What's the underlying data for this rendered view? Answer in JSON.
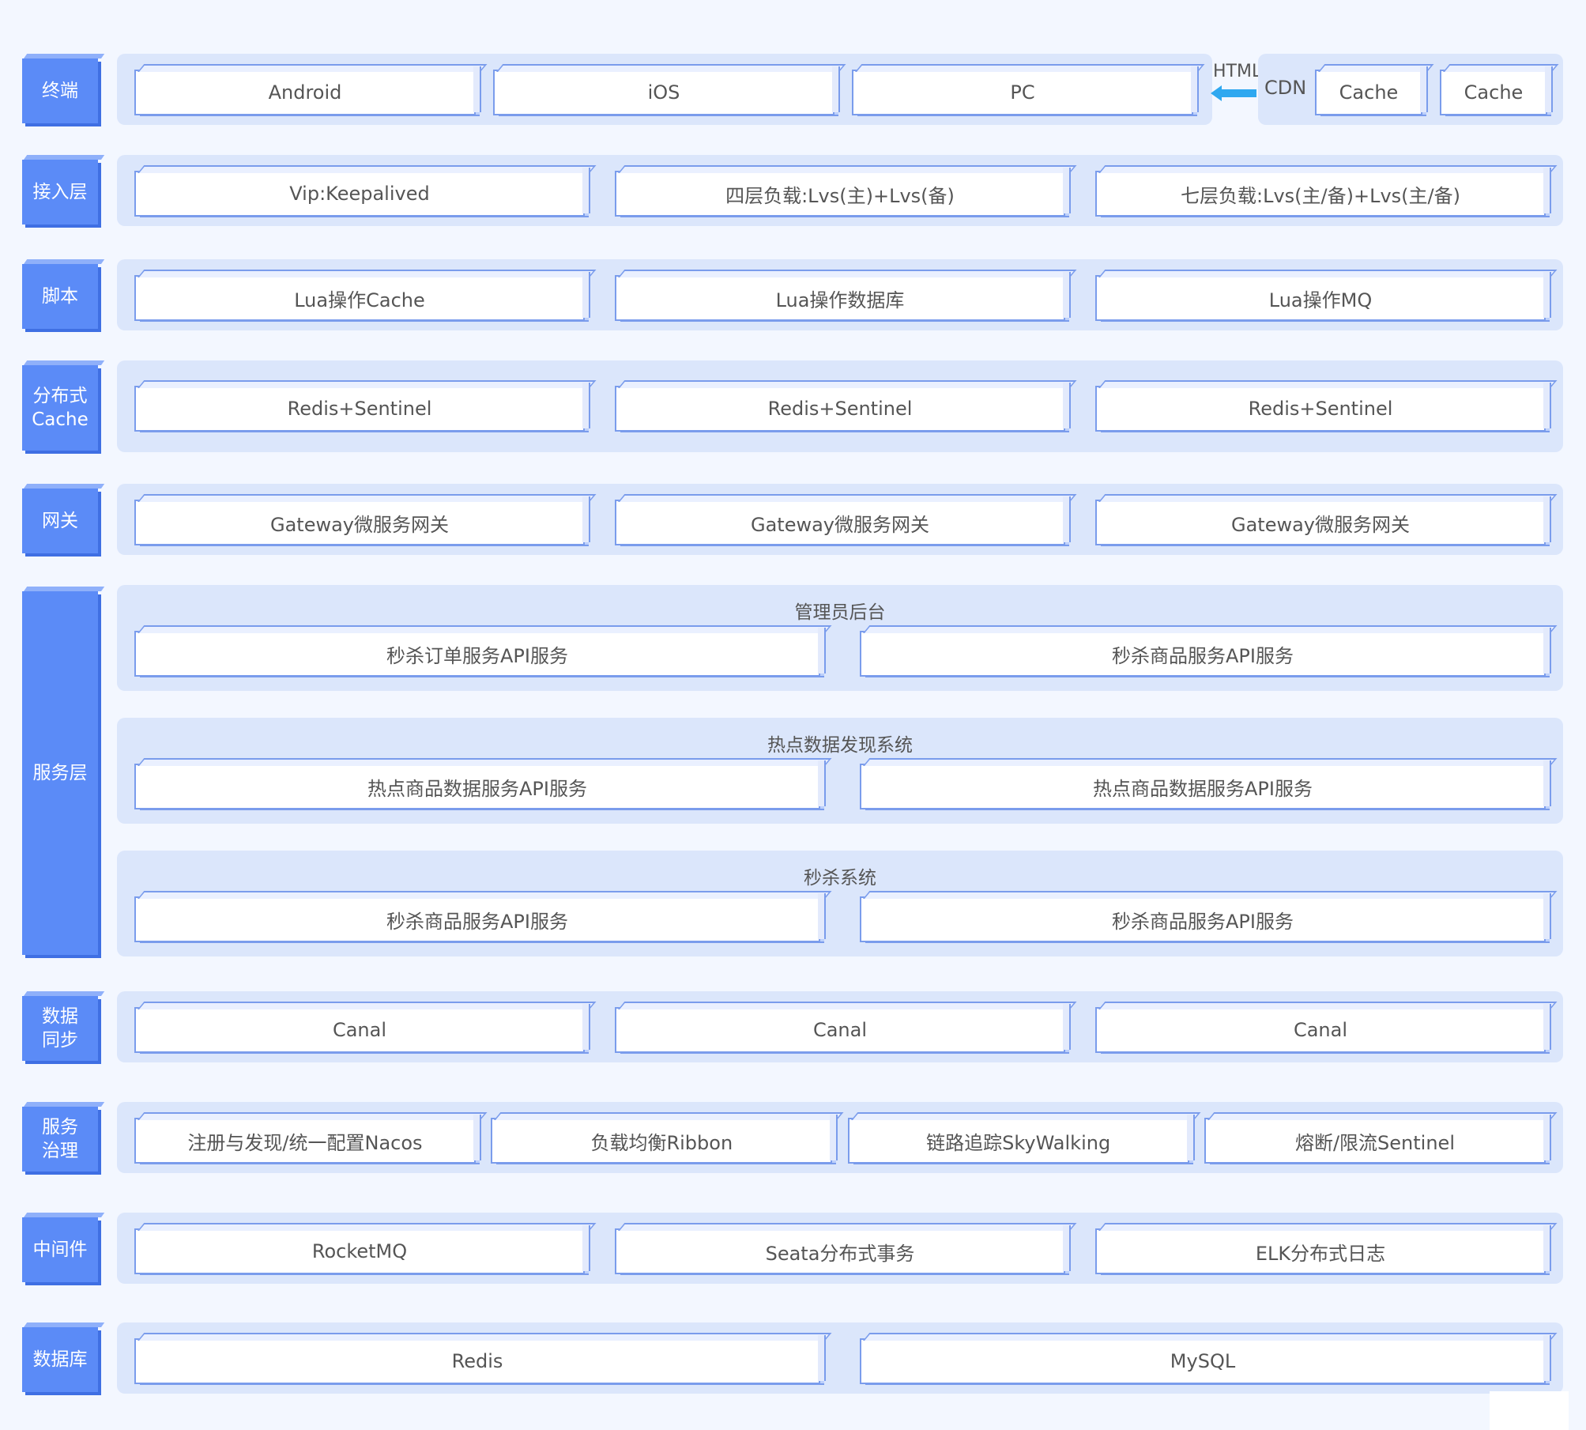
{
  "layers": {
    "terminal": {
      "label": "终端",
      "boxes": [
        "Android",
        "iOS",
        "PC"
      ],
      "html": "HTML",
      "cdn": "CDN",
      "cache": [
        "Cache",
        "Cache"
      ]
    },
    "access": {
      "label": "接入层",
      "boxes": [
        "Vip:Keepalived",
        "四层负载:Lvs(主)+Lvs(备)",
        "七层负载:Lvs(主/备)+Lvs(主/备)"
      ]
    },
    "script": {
      "label": "脚本",
      "boxes": [
        "Lua操作Cache",
        "Lua操作数据库",
        "Lua操作MQ"
      ]
    },
    "cache": {
      "label": "分布式Cache",
      "boxes": [
        "Redis+Sentinel",
        "Redis+Sentinel",
        "Redis+Sentinel"
      ]
    },
    "gateway": {
      "label": "网关",
      "boxes": [
        "Gateway微服务网关",
        "Gateway微服务网关",
        "Gateway微服务网关"
      ]
    },
    "service": {
      "label": "服务层",
      "groups": [
        {
          "title": "管理员后台",
          "boxes": [
            "秒杀订单服务API服务",
            "秒杀商品服务API服务"
          ]
        },
        {
          "title": "热点数据发现系统",
          "boxes": [
            "热点商品数据服务API服务",
            "热点商品数据服务API服务"
          ]
        },
        {
          "title": "秒杀系统",
          "boxes": [
            "秒杀商品服务API服务",
            "秒杀商品服务API服务"
          ]
        }
      ]
    },
    "sync": {
      "label": "数据同步",
      "boxes": [
        "Canal",
        "Canal",
        "Canal"
      ]
    },
    "governance": {
      "label": "服务治理",
      "boxes": [
        "注册与发现/统一配置Nacos",
        "负载均衡Ribbon",
        "链路追踪SkyWalking",
        "熔断/限流Sentinel"
      ]
    },
    "middleware": {
      "label": "中间件",
      "boxes": [
        "RocketMQ",
        "Seata分布式事务",
        "ELK分布式日志"
      ]
    },
    "database": {
      "label": "数据库",
      "boxes": [
        "Redis",
        "MySQL"
      ]
    }
  },
  "colors": {
    "label_bg": "#5b8bf7",
    "panel_bg": "#dbe6fb",
    "box_border": "#7a9cec",
    "arrow": "#2fa8f0"
  }
}
